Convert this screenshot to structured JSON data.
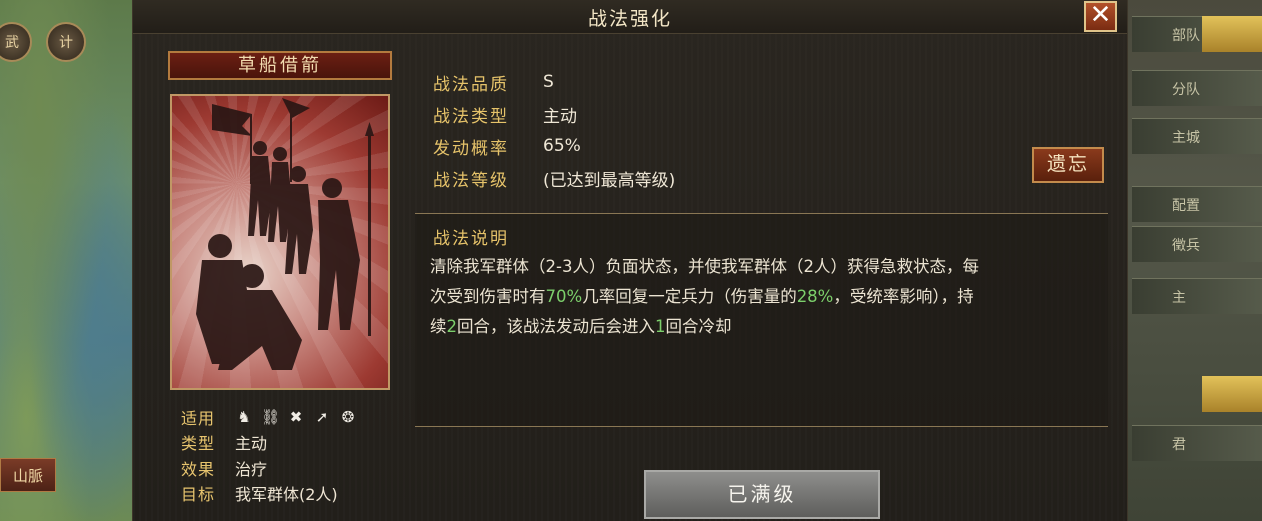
{
  "background": {
    "left_buttons": [
      "武",
      "计"
    ],
    "left_bottom_button": "山脈",
    "right_rows": [
      "部队",
      "分队",
      "主城",
      "配置",
      "徵兵",
      "主",
      "君"
    ]
  },
  "dialog": {
    "title": "战法强化",
    "close_symbol": "✕"
  },
  "card": {
    "name": "草船借箭",
    "stats": {
      "applies_label": "适用",
      "unit_icons": [
        "cavalry-icon",
        "shield-icon",
        "bow-icon",
        "spear-icon",
        "chariot-icon"
      ],
      "type_label": "类型",
      "type_value": "主动",
      "effect_label": "效果",
      "effect_value": "治疗",
      "target_label": "目标",
      "target_value": "我军群体(2人)"
    }
  },
  "info": {
    "quality_label": "战法品质",
    "quality_value": "S",
    "type_label": "战法类型",
    "type_value": "主动",
    "rate_label": "发动概率",
    "rate_value": "65%",
    "level_label": "战法等级",
    "level_value": "(已达到最高等级)"
  },
  "forget_button": "遗忘",
  "description": {
    "title": "战法说明",
    "line1": "清除我军群体（2-3人）负面状态，并使我军群体（2人）获得急救状态，每",
    "line2_a": "次受到伤害时有",
    "line2_b": "70%",
    "line2_c": "几率回复一定兵力（伤害量的",
    "line2_d": "28%",
    "line2_e": "，受统率影响），持",
    "line3_a": "续",
    "line3_b": "2",
    "line3_c": "回合，该战法发动后会进入",
    "line3_d": "1",
    "line3_e": "回合冷却"
  },
  "max_level_button": "已满级",
  "colors": {
    "label_gold": "#e6c36a",
    "highlight_green": "#7ccf6b",
    "close_red": "#b2512a"
  }
}
